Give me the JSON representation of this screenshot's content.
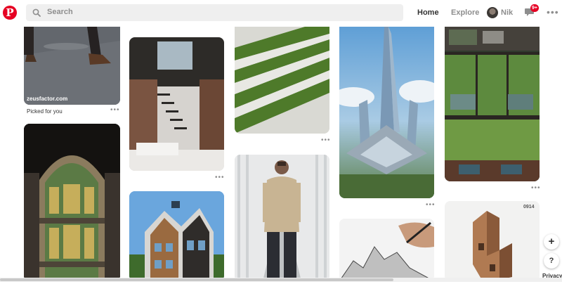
{
  "header": {
    "logo_glyph": "P",
    "search_placeholder": "Search",
    "nav_home": "Home",
    "nav_explore": "Explore",
    "user_name": "Nik",
    "notification_count": "9+",
    "more_label": "•••"
  },
  "pins": {
    "col1_top": {
      "overlay_text": "zeusfactor.com",
      "caption": "Picked for you",
      "more": "•••"
    },
    "col2_top": {
      "more": "•••"
    },
    "col3_top": {
      "more": "•••"
    },
    "col4_top": {
      "more": "•••"
    },
    "col5_top": {
      "more": "•••"
    },
    "col5_bottom": {
      "overlay_text": "0914"
    }
  },
  "floating": {
    "add_label": "+",
    "help_label": "?",
    "privacy_label": "Privacy"
  },
  "colors": {
    "brand": "#e60023",
    "search_bg": "#efefef",
    "muted_text": "#8e8e8e"
  }
}
